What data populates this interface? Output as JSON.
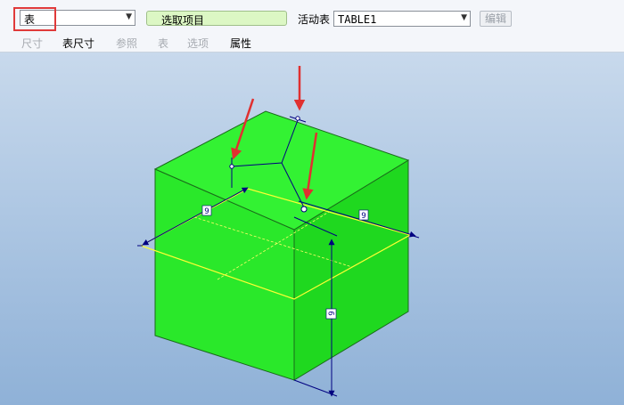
{
  "toolbar": {
    "type_select_value": "表",
    "pick_button_label": "选取项目",
    "active_table_label": "活动表",
    "active_table_value": "TABLE1",
    "edit_button_label": "编辑",
    "dropdown_arrow": "▼"
  },
  "menu": {
    "items": [
      {
        "label": "尺寸",
        "enabled": false
      },
      {
        "label": "表尺寸",
        "enabled": true
      },
      {
        "label": "参照",
        "enabled": false
      },
      {
        "label": "表",
        "enabled": false
      },
      {
        "label": "选项",
        "enabled": false
      },
      {
        "label": "属性",
        "enabled": true
      }
    ]
  },
  "model": {
    "dimension_labels": [
      "9",
      "9",
      "9"
    ],
    "colors": {
      "cube": "#22e622",
      "edge": "#1a6a1a",
      "table_plane": "#ffff33",
      "annotation": "#000080",
      "arrow": "#e03030"
    }
  }
}
